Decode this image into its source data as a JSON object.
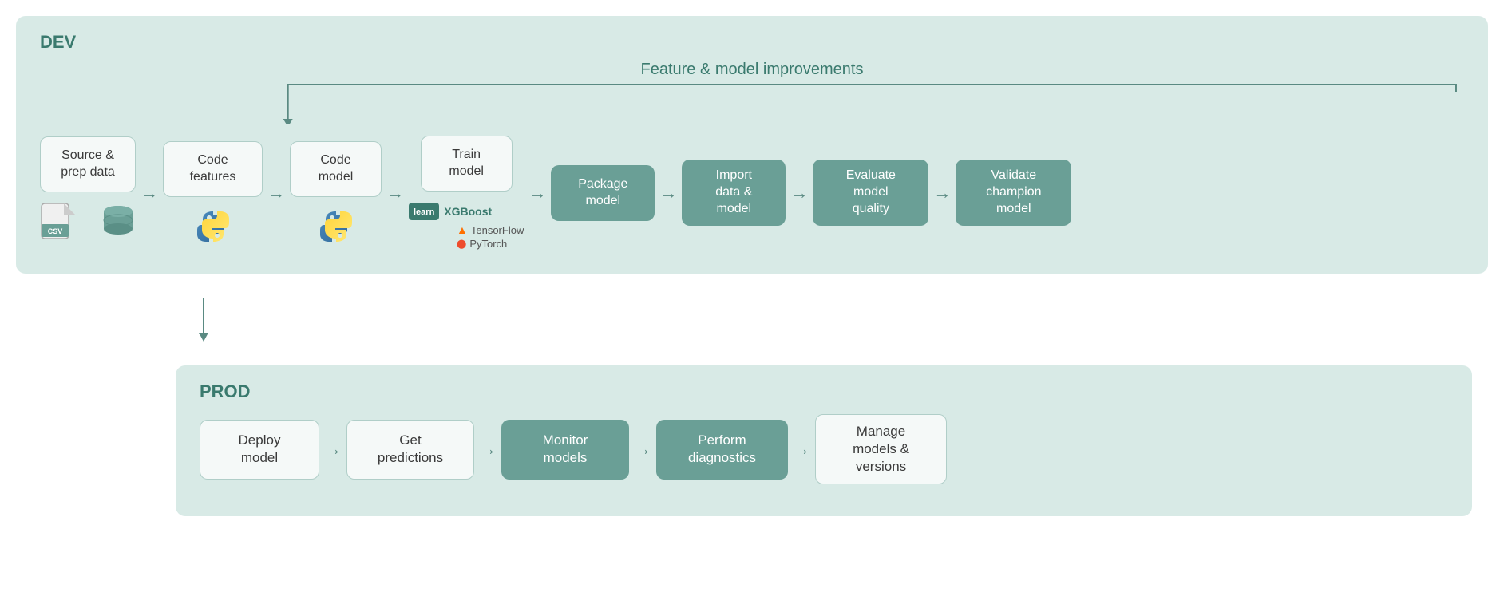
{
  "dev": {
    "label": "DEV",
    "feature_improvement": "Feature & model improvements",
    "nodes": [
      {
        "id": "source",
        "text": "Source &\nprep data",
        "type": "light"
      },
      {
        "id": "code-features",
        "text": "Code\nfeatures",
        "type": "light"
      },
      {
        "id": "code-model",
        "text": "Code\nmodel",
        "type": "light"
      },
      {
        "id": "train-model",
        "text": "Train\nmodel",
        "type": "light"
      },
      {
        "id": "package-model",
        "text": "Package\nmodel",
        "type": "dark"
      },
      {
        "id": "import-data",
        "text": "Import\ndata &\nmodel",
        "type": "dark"
      },
      {
        "id": "evaluate-model",
        "text": "Evaluate\nmodel\nquality",
        "type": "dark"
      },
      {
        "id": "validate-champion",
        "text": "Validate\nchampion\nmodel",
        "type": "dark"
      }
    ]
  },
  "prod": {
    "label": "PROD",
    "nodes": [
      {
        "id": "deploy-model",
        "text": "Deploy\nmodel",
        "type": "light"
      },
      {
        "id": "get-predictions",
        "text": "Get\npredictions",
        "type": "light"
      },
      {
        "id": "monitor-models",
        "text": "Monitor\nmodels",
        "type": "dark"
      },
      {
        "id": "perform-diagnostics",
        "text": "Perform\ndiagnostics",
        "type": "dark"
      },
      {
        "id": "manage-models",
        "text": "Manage\nmodels &\nversions",
        "type": "light"
      }
    ]
  },
  "icons": {
    "csv": "CSV",
    "db": "DB",
    "python": "🐍",
    "xgboost": "XGBoost",
    "sklearn": "learn",
    "tensorflow": "TensorFlow",
    "pytorch": "PyTorch"
  },
  "arrows": {
    "right": "→",
    "down": "↓"
  }
}
